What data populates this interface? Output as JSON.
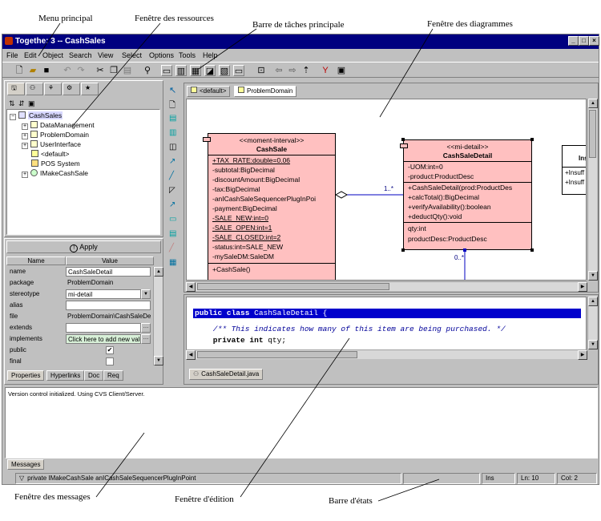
{
  "callouts": {
    "menu_principal": "Menu principal",
    "fenetre_ressources": "Fenêtre des ressources",
    "barre_taches": "Barre de tâches principale",
    "fenetre_diagrammes": "Fenêtre des diagrammes",
    "fenetre_messages": "Fenêtre des messages",
    "fenetre_edition": "Fenêtre d'édition",
    "barre_etats": "Barre d'états"
  },
  "window": {
    "title": "Togethe: 3 -- CashSales",
    "controls": [
      "_",
      "□",
      "×"
    ]
  },
  "menu": [
    "File",
    "Edit",
    "Object",
    "Search",
    "View",
    "Select",
    "Options",
    "Tools",
    "Help"
  ],
  "resources": {
    "tree": [
      {
        "label": "CashSales",
        "depth": 0,
        "expander": "⊟",
        "icon": "package-icon",
        "selected": true
      },
      {
        "label": "DataManagement",
        "depth": 1,
        "expander": "+",
        "icon": "folder-icon"
      },
      {
        "label": "ProblemDomain",
        "depth": 1,
        "expander": "+",
        "icon": "folder-icon"
      },
      {
        "label": "UserInterface",
        "depth": 1,
        "expander": "+",
        "icon": "folder-icon"
      },
      {
        "label": "<default>",
        "depth": 1,
        "expander": "",
        "icon": "diagram-icon"
      },
      {
        "label": "POS System",
        "depth": 1,
        "expander": "",
        "icon": "folder-icon"
      },
      {
        "label": "IMakeCashSale",
        "depth": 1,
        "expander": "+",
        "icon": "interface-icon"
      }
    ]
  },
  "properties": {
    "apply_label": "Apply",
    "col_name": "Name",
    "col_value": "Value",
    "rows": [
      {
        "name": "name",
        "value": "CashSaleDetail",
        "boxed": true
      },
      {
        "name": "package",
        "value": "ProblemDomain",
        "boxed": false
      },
      {
        "name": "stereotype",
        "value": "mi-detail",
        "boxed": true
      },
      {
        "name": "alias",
        "value": "",
        "boxed": true
      },
      {
        "name": "file",
        "value": "ProblemDomain\\CashSaleDe",
        "boxed": false
      },
      {
        "name": "extends",
        "value": "",
        "boxed": true
      },
      {
        "name": "implements",
        "value": "Click here to add new value...",
        "boxed": true
      },
      {
        "name": "public",
        "value": "✔",
        "boxed": false
      },
      {
        "name": "final",
        "value": "",
        "boxed": false
      }
    ],
    "tabs": [
      "Properties",
      "Hyperlinks",
      "Doc",
      "Req"
    ]
  },
  "diagram": {
    "tabs": [
      "<default>",
      "ProblemDomain"
    ],
    "cashsale": {
      "stereotype": "<<moment-interval>>",
      "name": "CashSale",
      "attributes": [
        "+TAX_RATE:double=0.06",
        "-subtotal:BigDecimal",
        "-discountAmount:BigDecimal",
        "-tax:BigDecimal",
        "-anICashSaleSequencerPlugInPoi",
        "-payment:BigDecimal",
        "-SALE_NEW:int=0",
        "-SALE_OPEN:int=1",
        "-SALE_CLOSED:int=2",
        "-status:int=SALE_NEW",
        "-mySaleDM:SaleDM"
      ],
      "operations": [
        "+CashSale()"
      ]
    },
    "detail": {
      "stereotype": "<<mi-detail>>",
      "name": "CashSaleDetail",
      "attributes": [
        "-UOM:int=0",
        "-product:ProductDesc"
      ],
      "operations": [
        "+CashSaleDetail(prod:ProductDes",
        "+calcTotal():BigDecimal",
        "+verifyAvailability():boolean",
        "+deductQty():void"
      ],
      "extra": [
        "qty:int",
        "productDesc:ProductDesc"
      ]
    },
    "third": {
      "name": "Ins",
      "rows": [
        "+Insuff",
        "+Insuff"
      ]
    },
    "mult_left": "1..*",
    "mult_bottom": "0..*"
  },
  "editor": {
    "lines": [
      {
        "kw": "public class ",
        "rest": "CashSaleDetail {"
      },
      {
        "comment": "    /** This indicates how many of this item are being purchased. */"
      },
      {
        "kw": "    private int ",
        "rest": "qty;"
      }
    ],
    "file_tab": "CashSaleDetail.java"
  },
  "messages": {
    "text": "Version control initialized. Using CVS Client/Server.",
    "tab": "Messages"
  },
  "status": {
    "main": "private IMakeCashSale anICashSaleSequencerPlugInPoint",
    "mode": "Ins",
    "line": "Ln: 10",
    "col": "Col: 2"
  },
  "colors": {
    "titlebar": "#000080",
    "class_fill": "#ffc0c0",
    "editor_highlight": "#0000cc",
    "comment": "#000099"
  }
}
